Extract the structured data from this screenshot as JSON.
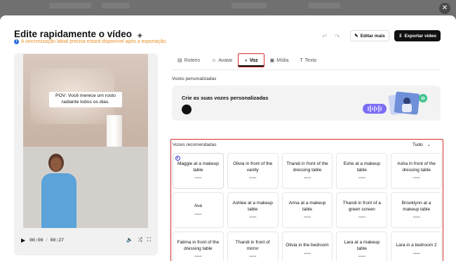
{
  "header": {
    "title": "Edite rapidamente o vídeo",
    "subnote": "A sincronização labial precisa estará disponível após a exportação.",
    "edit_more_label": "Editar mais",
    "export_label": "Exportar vídeo"
  },
  "video": {
    "caption": "POV: Você merece um rosto radiante todos os dias.",
    "current_time": "00:00",
    "duration": "00:27"
  },
  "tabs": [
    {
      "label": "Roteiro",
      "icon": "script-icon"
    },
    {
      "label": "Avatar",
      "icon": "avatar-icon"
    },
    {
      "label": "Voz",
      "icon": "voice-icon",
      "active": true
    },
    {
      "label": "Mídia",
      "icon": "media-icon"
    },
    {
      "label": "Texto",
      "icon": "text-icon"
    }
  ],
  "custom_voices": {
    "section_label": "Vozes personalizadas",
    "card_title": "Crie as suas vozes personalizadas"
  },
  "recommended": {
    "section_label": "Vozes recomendadas",
    "filter_label": "Tudo",
    "voices": [
      {
        "name": "Maggie at a makeup table",
        "selected": true
      },
      {
        "name": "Olivia in front of the vanity"
      },
      {
        "name": "Thandi in front of the dressing table"
      },
      {
        "name": "Eshe at a makeup table"
      },
      {
        "name": "Asha in front of the dressing table"
      },
      {
        "name": "Ava"
      },
      {
        "name": "Ashlee at a makeup table"
      },
      {
        "name": "Anna at a makeup table"
      },
      {
        "name": "Thandi in front of a green screen"
      },
      {
        "name": "Brooklynn at a makeup table"
      },
      {
        "name": "Fatima in front of the dressing table"
      },
      {
        "name": "Thandi in front of mirror"
      },
      {
        "name": "Olivia in the bedroom"
      },
      {
        "name": "Lara at a makeup table"
      },
      {
        "name": "Lara in a bedroom 2"
      }
    ]
  },
  "colors": {
    "accent_selected": "#3b33d6",
    "highlight_box": "#d32f2f",
    "warning_text": "#e8912d",
    "info_icon": "#2f6ddf"
  }
}
